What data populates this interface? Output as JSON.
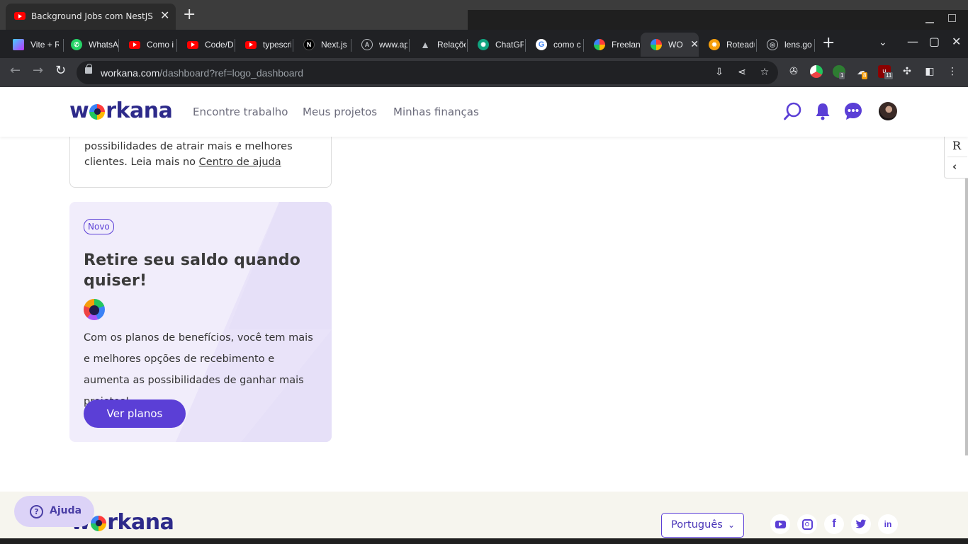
{
  "window": {
    "top_tab_title": "Background Jobs com NestJS - "
  },
  "tabs": [
    {
      "label": "Vite + R",
      "icon": "vite-icon",
      "color": "#a855f7"
    },
    {
      "label": "WhatsA",
      "icon": "whatsapp-icon",
      "color": "#25d366"
    },
    {
      "label": "Como i",
      "icon": "youtube-icon",
      "color": "#ff0000"
    },
    {
      "label": "Code/D",
      "icon": "youtube-icon",
      "color": "#ff0000"
    },
    {
      "label": "typescri",
      "icon": "youtube-icon",
      "color": "#ff0000"
    },
    {
      "label": "Next.js",
      "icon": "nextjs-icon",
      "color": "#000000"
    },
    {
      "label": "www.ap",
      "icon": "a-circle-icon",
      "color": "#bdc1c6"
    },
    {
      "label": "Relaçõe",
      "icon": "prisma-icon",
      "color": "#bdc1c6"
    },
    {
      "label": "ChatGP",
      "icon": "chatgpt-icon",
      "color": "#10a37f"
    },
    {
      "label": "como c",
      "icon": "google-icon",
      "color": "#4285f4"
    },
    {
      "label": "Freelan",
      "icon": "workana-icon",
      "color": "#ff3b3b"
    },
    {
      "label": "WOI",
      "icon": "workana-icon",
      "color": "#ff3b3b"
    },
    {
      "label": "Roteadu",
      "icon": "sun-icon",
      "color": "#f59e0b"
    },
    {
      "label": "lens.go",
      "icon": "lens-icon",
      "color": "#bdc1c6"
    }
  ],
  "address": {
    "host": "workana.com",
    "path": "/dashboard?ref=logo_dashboard"
  },
  "extensions": {
    "badge_1": "1",
    "badge_2": "8",
    "badge_3": "11"
  },
  "site": {
    "logo_text_pre": "w",
    "logo_text_post": "rkana",
    "nav": [
      "Encontre trabalho",
      "Meus projetos",
      "Minhas finanças"
    ]
  },
  "side_widget": {
    "letter": "R"
  },
  "help_card": {
    "text": "possibilidades de atrair mais e melhores clientes. Leia mais no ",
    "link": "Centro de ajuda"
  },
  "promo": {
    "badge": "Novo",
    "title": "Retire seu saldo quando quiser!",
    "body": "Com os planos de benefícios, você tem mais e melhores opções de recebimento e aumenta as possibilidades de ganhar mais projetos!",
    "button": "Ver planos"
  },
  "footer": {
    "language": "Português",
    "social": [
      "youtube-icon",
      "instagram-icon",
      "facebook-icon",
      "twitter-icon",
      "linkedin-icon"
    ]
  },
  "help_button": {
    "label": "Ajuda"
  },
  "colors": {
    "brand_purple": "#5b3fd6",
    "logo_navy": "#2d2a8a",
    "promo_bg": "#f1edfb",
    "footer_bg": "#f6f5ee"
  }
}
